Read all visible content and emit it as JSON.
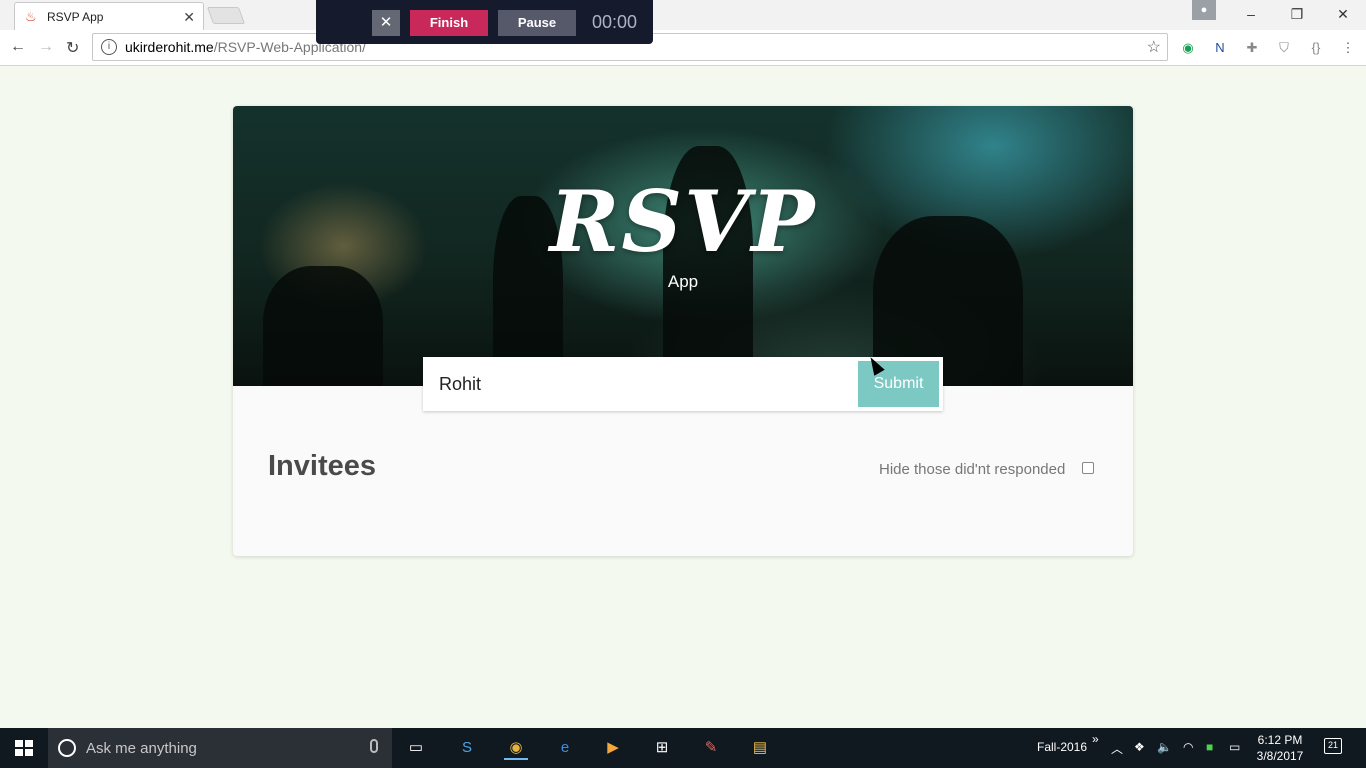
{
  "browser": {
    "tab_title": "RSVP App",
    "tab_close": "✕",
    "url_host": "ukirderohit.me",
    "url_path": "/RSVP-Web-Application/"
  },
  "recorder": {
    "close_label": "✕",
    "finish_label": "Finish",
    "pause_label": "Pause",
    "timer": "00:00"
  },
  "hero": {
    "title": "RSVP",
    "subtitle": "App"
  },
  "form": {
    "name_value": "Rohit",
    "submit_label": "Submit"
  },
  "invitees": {
    "heading": "Invitees",
    "hide_label": "Hide those did'nt responded",
    "hide_checked": false
  },
  "taskbar": {
    "search_placeholder": "Ask me anything",
    "tray_label": "Fall-2016",
    "time": "6:12 PM",
    "date": "3/8/2017",
    "notification_count": "21"
  },
  "colors": {
    "page_bg": "#f4f9ef",
    "submit_bg": "#7cc8c2",
    "finish_bg": "#c8285a"
  }
}
